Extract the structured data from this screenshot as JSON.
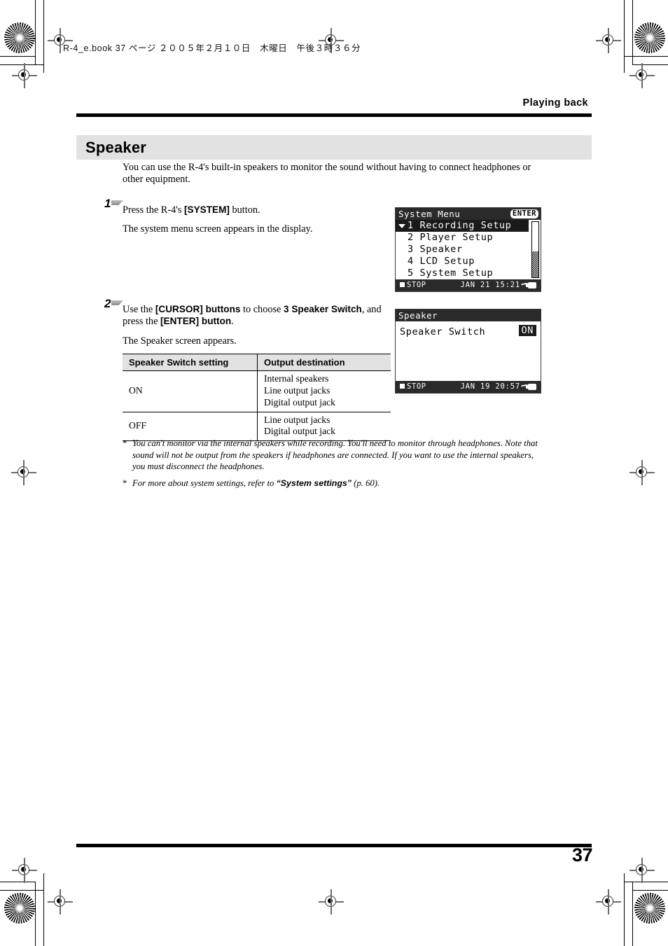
{
  "print_marks": {
    "bookmark_line": "R-4_e.book 37 ページ ２００５年２月１０日　木曜日　午後３時３６分"
  },
  "header": {
    "running_head": "Playing back"
  },
  "heading": {
    "title": "Speaker"
  },
  "intro": "You can use the R-4's built-in speakers to monitor the sound without having to connect headphones or other equipment.",
  "steps": [
    {
      "number": "1",
      "lines": [
        "Press the R-4's [SYSTEM] button.",
        "The system menu screen appears in the display."
      ],
      "bold_parts": [
        "[SYSTEM]"
      ]
    },
    {
      "number": "2",
      "lines": [
        "Use the [CURSOR] buttons to choose 3 Speaker Switch, and press the [ENTER] button.",
        "The Speaker screen appears."
      ]
    }
  ],
  "step1": {
    "line1_a": "Press the R-4's ",
    "line1_b": "[SYSTEM]",
    "line1_c": " button.",
    "line2": "The system menu screen appears in the display."
  },
  "step2": {
    "line1_a": "Use the ",
    "line1_b": "[CURSOR] buttons",
    "line1_c": " to choose ",
    "line1_d": "3 Speaker Switch",
    "line1_e": ", and press the ",
    "line1_f": "[ENTER] button",
    "line1_g": ".",
    "line2": "The Speaker screen appears."
  },
  "lcd_system_menu": {
    "title": "System Menu",
    "enter_badge": "ENTER",
    "items": [
      {
        "num": "1",
        "label": "Recording Setup",
        "selected": true
      },
      {
        "num": "2",
        "label": "Player Setup",
        "selected": false
      },
      {
        "num": "3",
        "label": "Speaker",
        "selected": false
      },
      {
        "num": "4",
        "label": "LCD Setup",
        "selected": false
      },
      {
        "num": "5",
        "label": "System Setup",
        "selected": false
      }
    ],
    "status": {
      "transport": "STOP",
      "date": "JAN 21",
      "time": "15:21"
    }
  },
  "lcd_speaker": {
    "title": "Speaker",
    "field_label": "Speaker Switch",
    "field_value": "ON",
    "status": {
      "transport": "STOP",
      "date": "JAN 19",
      "time": "20:57"
    }
  },
  "table": {
    "headers": [
      "Speaker Switch setting",
      "Output destination"
    ],
    "rows": [
      {
        "setting": "ON",
        "destinations": [
          "Internal speakers",
          "Line output jacks",
          "Digital output jack"
        ]
      },
      {
        "setting": "OFF",
        "destinations": [
          "Line output jacks",
          "Digital output jack"
        ]
      }
    ]
  },
  "notes": [
    {
      "marker": "*",
      "text": "You can't monitor via the internal speakers while recording. You'll need to monitor through headphones. Note that sound will not be output from the speakers if headphones are connected. If you want to use the internal speakers, you must disconnect the headphones."
    },
    {
      "marker": "*",
      "prefix": "For more about system settings, refer to ",
      "bold": "“System settings”",
      "suffix": " (p. 60)."
    }
  ],
  "footer": {
    "page_number": "37"
  },
  "colors": {
    "heading_bar": "#e2e2e2",
    "rule": "#000000",
    "lcd_dark": "#2a2a2a",
    "lcd_light": "#ffffff"
  }
}
